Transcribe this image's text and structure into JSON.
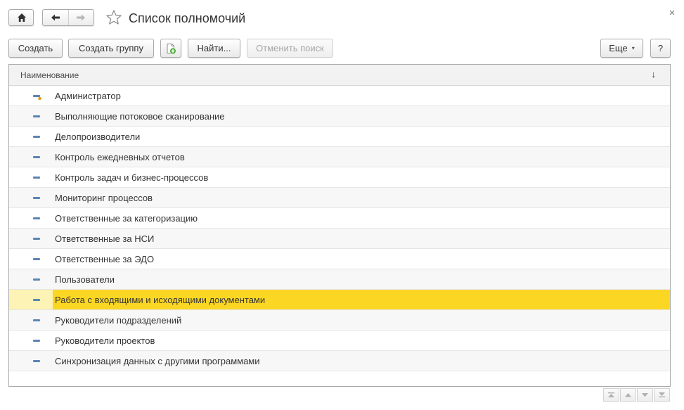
{
  "window": {
    "title": "Список полномочий",
    "close_glyph": "×"
  },
  "icons": {
    "home": "home-icon",
    "back": "arrow-left-icon",
    "forward": "arrow-right-icon",
    "favorite": "star-icon",
    "close": "close-icon",
    "add_copy": "add-document-icon",
    "admin_item": "item-with-key-icon",
    "item": "item-icon"
  },
  "toolbar": {
    "create": "Создать",
    "create_group": "Создать группу",
    "find": "Найти...",
    "cancel_search": "Отменить поиск",
    "more": "Еще",
    "more_caret": "▾",
    "help": "?"
  },
  "table": {
    "column": "Наименование",
    "sort_indicator": "↓",
    "rows": [
      "Администратор",
      "Выполняющие потоковое сканирование",
      "Делопроизводители",
      "Контроль ежедневных отчетов",
      "Контроль задач и бизнес-процессов",
      "Мониторинг процессов",
      "Ответственные за категоризацию",
      "Ответственные за НСИ",
      "Ответственные за ЭДО",
      "Пользователи",
      "Работа с входящими и исходящими документами",
      "Руководители подразделений",
      "Руководители проектов",
      "Синхронизация данных с другими программами"
    ],
    "selected_row": "Работа с входящими и исходящими документами"
  },
  "colors": {
    "selection": "#fbd724",
    "selection_row": "#fdf3b5",
    "item_icon": "#5b84b5"
  }
}
